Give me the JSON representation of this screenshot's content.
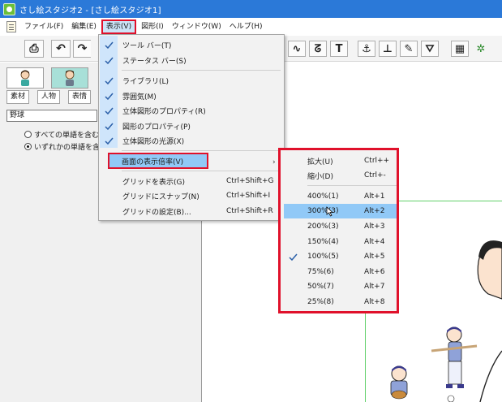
{
  "window": {
    "title": "さし絵スタジオ2 - [さし絵スタジオ1]"
  },
  "menubar": {
    "items": [
      "ファイル(F)",
      "編集(E)",
      "表示(V)",
      "図形(I)",
      "ウィンドウ(W)",
      "ヘルプ(H)"
    ],
    "active_index": 2
  },
  "toolbar": {
    "left": {
      "undo_glyph": "↶",
      "redo_glyph": "↷",
      "print_glyph": "⎙"
    },
    "right": {
      "curve_glyph": "∿",
      "shape_glyph": "ᘔ",
      "text_glyph": "T",
      "anchor_glyph": "⚓",
      "pin_glyph": "⊥",
      "pen_glyph": "✎",
      "fill_glyph": "⛛",
      "grid_glyph": "▦",
      "gear_glyph": "✲"
    }
  },
  "left_panel": {
    "category_tabs": [
      "素材",
      "人物",
      "表情"
    ],
    "search_value": "野球",
    "search_options": [
      {
        "label": "すべての単語を含む",
        "selected": false
      },
      {
        "label": "いずれかの単語を含む",
        "selected": true
      }
    ]
  },
  "view_menu": {
    "items": [
      {
        "label": "ツール バー(T)",
        "checked": true,
        "shortcut": ""
      },
      {
        "label": "ステータス バー(S)",
        "checked": true,
        "shortcut": ""
      },
      {
        "label": "ライブラリ(L)",
        "checked": true,
        "shortcut": ""
      },
      {
        "label": "雰囲気(M)",
        "checked": true,
        "shortcut": ""
      },
      {
        "label": "立体図形のプロパティ(R)",
        "checked": true,
        "shortcut": ""
      },
      {
        "label": "図形のプロパティ(P)",
        "checked": true,
        "shortcut": ""
      },
      {
        "label": "立体図形の光源(X)",
        "checked": true,
        "shortcut": ""
      },
      {
        "label": "画面の表示倍率(V)",
        "checked": false,
        "shortcut": "",
        "submenu_arrow": "›"
      },
      {
        "label": "グリッドを表示(G)",
        "checked": false,
        "shortcut": "Ctrl+Shift+G"
      },
      {
        "label": "グリッドにスナップ(N)",
        "checked": false,
        "shortcut": "Ctrl+Shift+I"
      },
      {
        "label": "グリッドの設定(B)...",
        "checked": false,
        "shortcut": "Ctrl+Shift+R"
      }
    ]
  },
  "zoom_submenu": {
    "items": [
      {
        "label": "拡大(U)",
        "shortcut": "Ctrl++",
        "checked": false
      },
      {
        "label": "縮小(D)",
        "shortcut": "Ctrl+-",
        "checked": false
      },
      {
        "label": "400%(1)",
        "shortcut": "Alt+1",
        "checked": false
      },
      {
        "label": "300%(3)",
        "shortcut": "Alt+2",
        "checked": false
      },
      {
        "label": "200%(3)",
        "shortcut": "Alt+3",
        "checked": false
      },
      {
        "label": "150%(4)",
        "shortcut": "Alt+4",
        "checked": false
      },
      {
        "label": "100%(5)",
        "shortcut": "Alt+5",
        "checked": true
      },
      {
        "label": "75%(6)",
        "shortcut": "Alt+6",
        "checked": false
      },
      {
        "label": "50%(7)",
        "shortcut": "Alt+7",
        "checked": false
      },
      {
        "label": "25%(8)",
        "shortcut": "Alt+8",
        "checked": false
      }
    ],
    "hover_index": 3
  },
  "colors": {
    "titlebar": "#2b79d8",
    "highlight": "#91c9f7",
    "annotation_red": "#e0112b",
    "guide_green": "#62d06a"
  }
}
